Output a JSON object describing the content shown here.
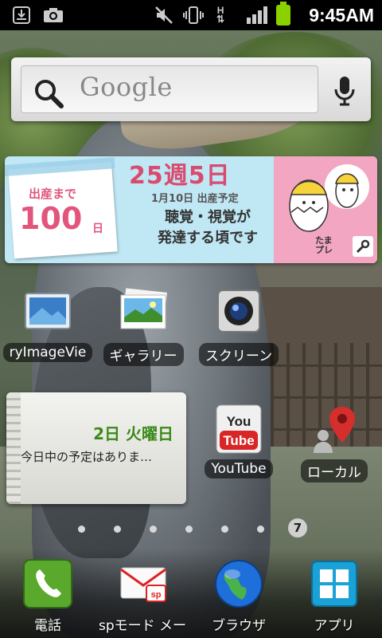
{
  "status_bar": {
    "time": "9:45AM",
    "network_label": "H",
    "icons": [
      "download-icon",
      "camera-icon",
      "silent-mode-icon",
      "vibrate-icon",
      "data-transfer-icon",
      "signal-icon",
      "battery-icon"
    ],
    "battery_color": "#8bd100"
  },
  "search_widget": {
    "placeholder": "Google",
    "icons": [
      "search-icon",
      "microphone-icon"
    ]
  },
  "pregnancy_widget": {
    "countdown_label": "出産まで",
    "countdown_days": "100",
    "countdown_unit": "日",
    "week_line": "25週5日",
    "due_date": "1月10日 出産予定",
    "message_line1": "聴覚・視覚が",
    "message_line2": "発達する頃です",
    "brand": "たまプレ",
    "accent_color": "#d94a6e"
  },
  "apps_row1": [
    {
      "label": "ryImageVie",
      "icon": "image-viewer-icon"
    },
    {
      "label": "ギャラリー",
      "icon": "gallery-icon"
    },
    {
      "label": "スクリーン",
      "icon": "screen-capture-icon"
    }
  ],
  "calendar_widget": {
    "date": "2日 火曜日",
    "event_text": "今日中の予定はありま…",
    "date_color": "#3b8a1a"
  },
  "apps_row2": [
    {
      "label": "YouTube",
      "icon": "youtube-icon"
    },
    {
      "label": "ローカル",
      "icon": "local-maps-icon"
    }
  ],
  "page_indicator": {
    "current_page": "7",
    "total_dots": 7
  },
  "dock": [
    {
      "label": "電話",
      "icon": "phone-icon"
    },
    {
      "label": "spモード メール",
      "icon": "mail-icon"
    },
    {
      "label": "ブラウザ",
      "icon": "browser-globe-icon"
    },
    {
      "label": "アプリ",
      "icon": "app-drawer-icon"
    }
  ]
}
